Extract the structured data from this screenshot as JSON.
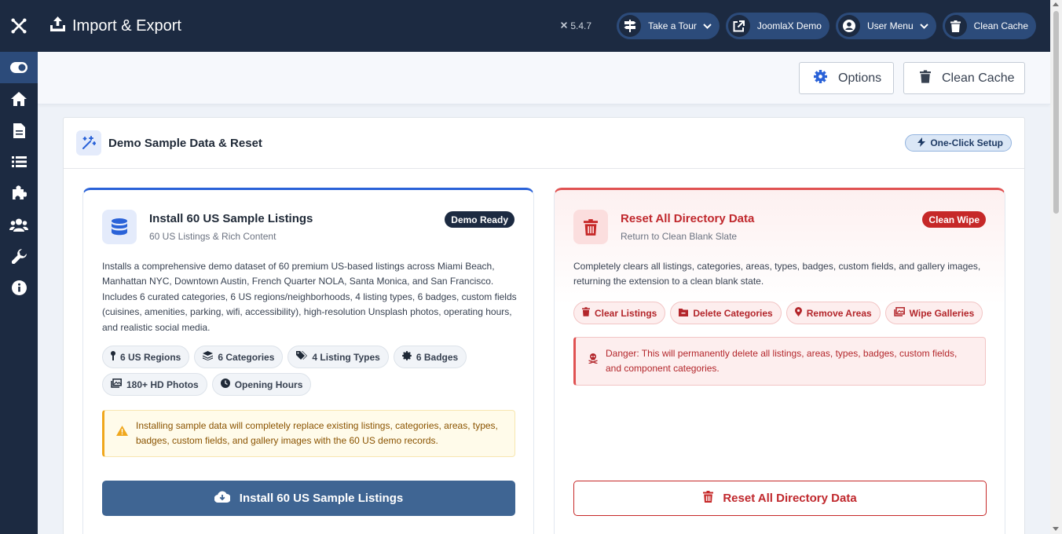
{
  "header": {
    "title": "Import & Export",
    "version": "5.4.7",
    "buttons": {
      "tour": "Take a Tour",
      "demo": "JoomlaX Demo",
      "user_menu": "User Menu",
      "clean_cache": "Clean Cache"
    }
  },
  "sidebar": {
    "items": [
      {
        "icon": "toggle-icon",
        "active": true
      },
      {
        "icon": "home-icon"
      },
      {
        "icon": "file-icon"
      },
      {
        "icon": "list-icon"
      },
      {
        "icon": "puzzle-icon"
      },
      {
        "icon": "users-icon"
      },
      {
        "icon": "wrench-icon"
      },
      {
        "icon": "info-icon"
      }
    ]
  },
  "toolbar": {
    "options": "Options",
    "clean_cache": "Clean Cache"
  },
  "card": {
    "title": "Demo Sample Data & Reset",
    "badge": "One-Click Setup"
  },
  "install": {
    "title": "Install 60 US Sample Listings",
    "subtitle": "60 US Listings & Rich Content",
    "badge": "Demo Ready",
    "description": "Installs a comprehensive demo dataset of 60 premium US-based listings across Miami Beach, Manhattan NYC, Downtown Austin, French Quarter NOLA, Santa Monica, and San Francisco. Includes 6 curated categories, 6 US regions/neighborhoods, 4 listing types, 6 badges, custom fields (cuisines, amenities, parking, wifi, accessibility), high-resolution Unsplash photos, operating hours, and realistic social media.",
    "chips": [
      "6 US Regions",
      "6 Categories",
      "4 Listing Types",
      "6 Badges",
      "180+ HD Photos",
      "Opening Hours"
    ],
    "warning": "Installing sample data will completely replace existing listings, categories, areas, types, badges, custom fields, and gallery images with the 60 US demo records.",
    "button": "Install 60 US Sample Listings"
  },
  "reset": {
    "title": "Reset All Directory Data",
    "subtitle": "Return to Clean Blank Slate",
    "badge": "Clean Wipe",
    "description": "Completely clears all listings, categories, areas, types, badges, custom fields, and gallery images, returning the extension to a clean blank state.",
    "chips": [
      "Clear Listings",
      "Delete Categories",
      "Remove Areas",
      "Wipe Galleries"
    ],
    "danger": "Danger: This will permanently delete all listings, areas, types, badges, custom fields, and component categories.",
    "button": "Reset All Directory Data"
  },
  "colors": {
    "navy": "#1c2a41",
    "active_blue": "#2c4b7a",
    "primary_button": "#3f6593",
    "danger_red": "#c62828",
    "warning_amber": "#f0a71c"
  }
}
